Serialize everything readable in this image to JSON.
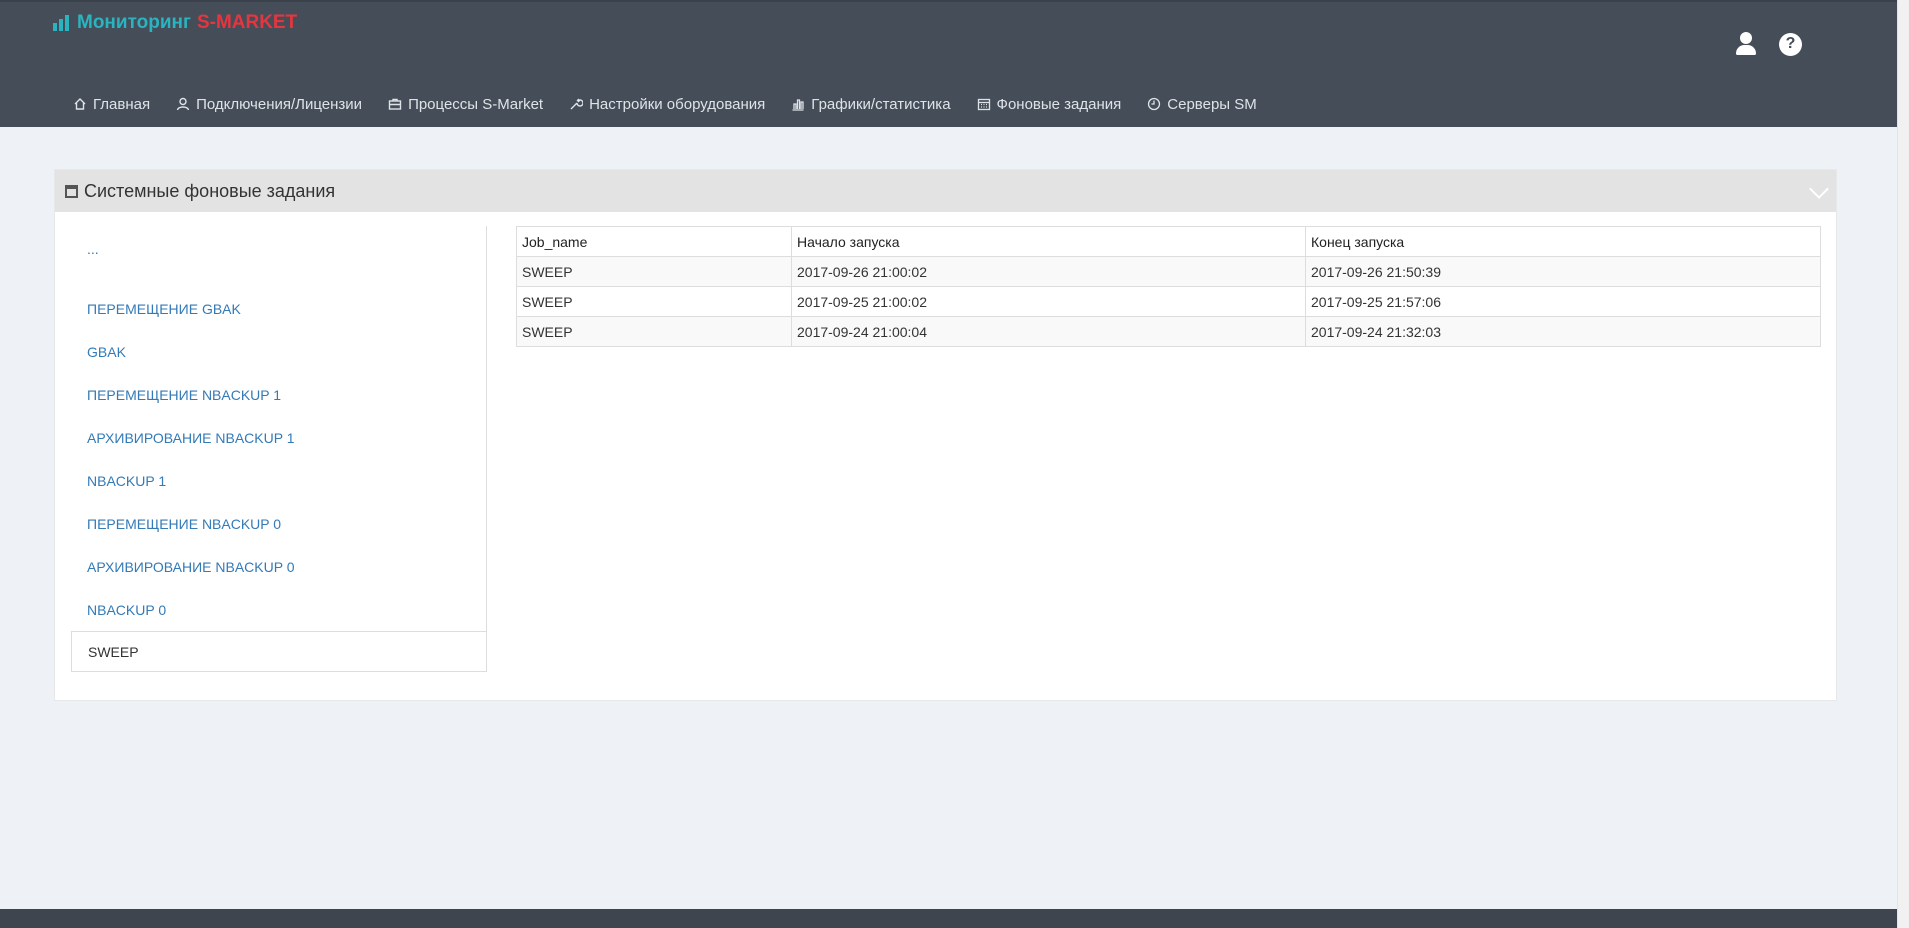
{
  "app": {
    "brand_part1": "Мониторинг",
    "brand_part2": "S-MARKET",
    "brand_color1": "#2ab4c0",
    "brand_color2": "#e7353f"
  },
  "header": {
    "user_icon": "user-icon",
    "help_icon": "help-icon",
    "help_glyph": "?"
  },
  "nav": {
    "items": [
      {
        "label": "Главная",
        "icon": "home-icon"
      },
      {
        "label": "Подключения/Лицензии",
        "icon": "user-icon"
      },
      {
        "label": "Процессы S-Market",
        "icon": "briefcase-icon"
      },
      {
        "label": "Настройки оборудования",
        "icon": "wrench-icon"
      },
      {
        "label": "Графики/статистика",
        "icon": "bar-chart-icon"
      },
      {
        "label": "Фоновые задания",
        "icon": "calendar-icon"
      },
      {
        "label": "Серверы SM",
        "icon": "clock-icon"
      }
    ]
  },
  "panel": {
    "title": "Системные фоновые задания",
    "side_items": [
      {
        "label": "..."
      },
      {
        "label": "ПЕРЕМЕЩЕНИЕ GBAK"
      },
      {
        "label": "GBAK"
      },
      {
        "label": "ПЕРЕМЕЩЕНИЕ NBACKUP 1"
      },
      {
        "label": "АРХИВИРОВАНИЕ NBACKUP 1"
      },
      {
        "label": "NBACKUP 1"
      },
      {
        "label": "ПЕРЕМЕЩЕНИЕ NBACKUP 0"
      },
      {
        "label": "АРХИВИРОВАНИЕ NBACKUP 0"
      },
      {
        "label": "NBACKUP 0"
      },
      {
        "label": "SWEEP"
      }
    ],
    "table": {
      "headers": [
        "Job_name",
        "Начало запуска",
        "Конец запуска"
      ],
      "rows": [
        [
          "SWEEP",
          "2017-09-26 21:00:02",
          "2017-09-26 21:50:39"
        ],
        [
          "SWEEP",
          "2017-09-25 21:00:02",
          "2017-09-25 21:57:06"
        ],
        [
          "SWEEP",
          "2017-09-24 21:00:04",
          "2017-09-24 21:32:03"
        ]
      ]
    }
  }
}
